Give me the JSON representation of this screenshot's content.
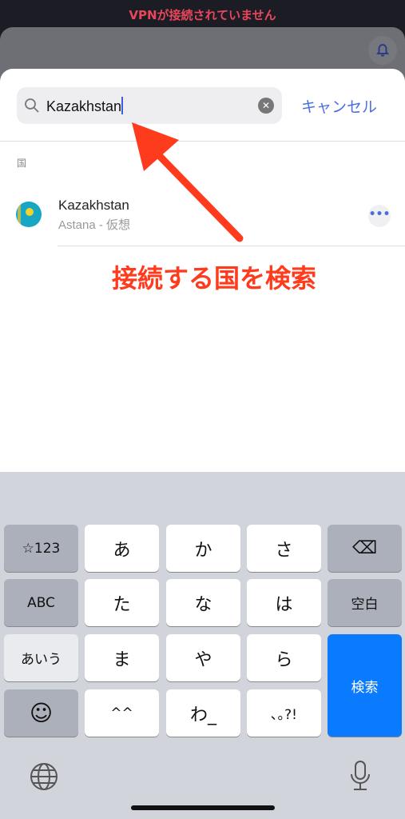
{
  "status_banner": "VPNが接続されていません",
  "search": {
    "value": "Kazakhstan",
    "cancel_label": "キャンセル"
  },
  "section_label": "国",
  "results": [
    {
      "name": "Kazakhstan",
      "subtitle": "Astana - 仮想",
      "flag": "kazakhstan-flag"
    }
  ],
  "annotation": "接続する国を検索",
  "accent_color": "#4a6ee0",
  "keyboard": {
    "rows": [
      [
        "☆123",
        "あ",
        "か",
        "さ",
        "⌫"
      ],
      [
        "ABC",
        "た",
        "な",
        "は",
        "空白"
      ],
      [
        "あいう",
        "ま",
        "や",
        "ら",
        "検索"
      ],
      [
        "☺",
        "^^",
        "わ_",
        "､｡?!"
      ]
    ]
  }
}
